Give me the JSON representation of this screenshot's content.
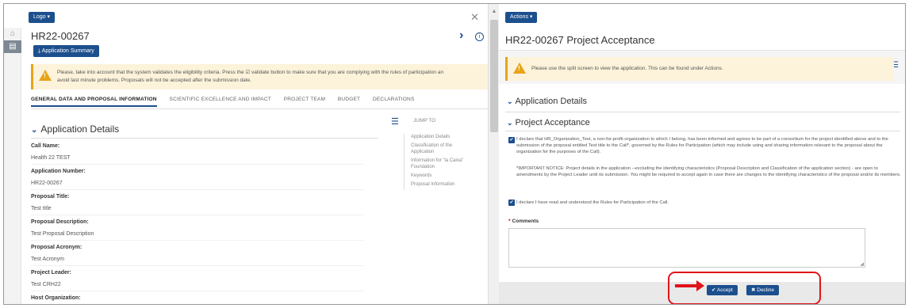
{
  "left": {
    "logo_button": "Logo ▾",
    "reference": "HR22-00267",
    "summary_button": "Application Summary",
    "warning": "Please, take into account that the system validates the eligibility criteria. Press the ☑ validate button to make sure that you are complying with the rules of participation an",
    "warning_line2": "avoid last minute problems. Proposals will not be accepted after the submission date.",
    "tabs": [
      "GENERAL DATA AND PROPOSAL INFORMATION",
      "SCIENTIFIC EXCELLENCE AND IMPACT",
      "PROJECT TEAM",
      "BUDGET",
      "DECLARATIONS"
    ],
    "section_title": "Application Details",
    "fields": [
      {
        "label": "Call Name:",
        "value": "Health 22 TEST"
      },
      {
        "label": "Application Number:",
        "value": "HR22-00267"
      },
      {
        "label": "Proposal Title:",
        "value": "Test title"
      },
      {
        "label": "Proposal Description:",
        "value": "Test Proposal Description"
      },
      {
        "label": "Proposal Acronym:",
        "value": "Test Acronym"
      },
      {
        "label": "Project Leader:",
        "value": "Test CRH22"
      },
      {
        "label": "Host Organization:",
        "value": ""
      }
    ],
    "jump_to": "JUMP TO",
    "jump_links": [
      "Application Details",
      "Classification of the Application",
      "Information for \"la Caixa\" Foundation",
      "Keywords",
      "Proposal Information"
    ]
  },
  "right": {
    "actions_button": "Actions ▾",
    "title": "HR22-00267 Project Acceptance",
    "warning": "Please use the split screen to view the application. This can be found under Actions.",
    "section_application": "Application Details",
    "section_acceptance": "Project Acceptance",
    "declaration1": "I declare that HR_Organization_Test, a non-for-profit organization to which I belong, has been informed and agrees to be part of a consortium for the project identified above and to the submission of the proposal entitled Test title to the Call*, governed by the Rules for Participation (which may include using and sharing information relevant to the proposal about the organization for the purposes of the Call).",
    "notice": "*IMPORTANT NOTICE: Project details in the application --excluding the identifying characteristics (Proposal Description and Classification of the application section) - are open to amendments by the Project Leader until its submission. You might be required to accept again in case there are changes to the identifying characteristics of the proposal and/or its members.",
    "declaration2": "I declare I have read and understood the Rules for Participation of the Call.",
    "comments_label": "Comments",
    "accept_button": "✔ Accept",
    "decline_button": "✖ Decline"
  },
  "colors": {
    "primary": "#1c4f8e",
    "warning": "#e8a317",
    "highlight": "#e0141b"
  }
}
